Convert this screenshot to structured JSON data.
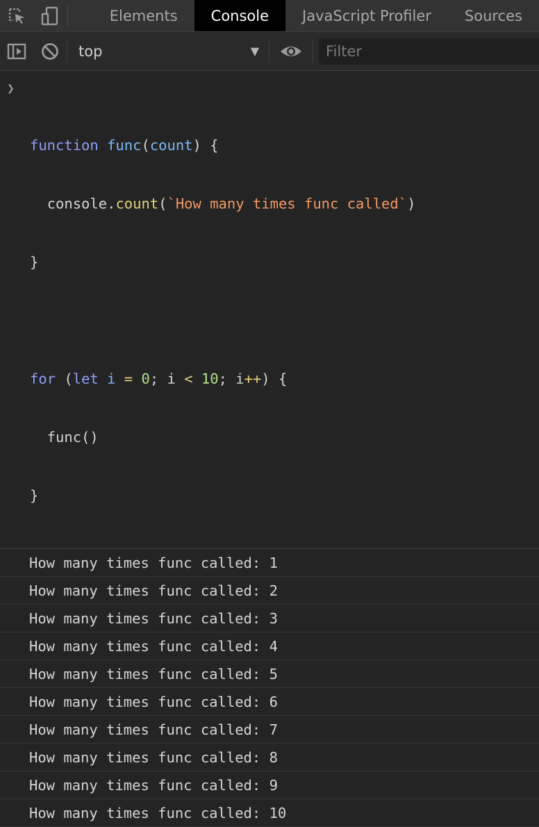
{
  "tabs": [
    {
      "label": "Elements",
      "active": false
    },
    {
      "label": "Console",
      "active": true
    },
    {
      "label": "JavaScript Profiler",
      "active": false
    },
    {
      "label": "Sources",
      "active": false
    }
  ],
  "toolbar": {
    "context": "top",
    "filter_placeholder": "Filter"
  },
  "input_code": {
    "line1": {
      "kw": "function",
      "name": "func",
      "paren_open": "(",
      "param": "count",
      "rest": ") {"
    },
    "line2": {
      "indent": "  ",
      "obj": "console.",
      "method": "count",
      "paren_open": "(",
      "str": "`How many times func called`",
      "paren_close": ")"
    },
    "line3": "}",
    "line5": {
      "kw": "for",
      "p1": " (",
      "let": "let",
      "sp": " ",
      "var": "i",
      "eq": " = ",
      "zero": "0",
      "semi1": "; i ",
      "lt": "<",
      "sp2": " ",
      "ten": "10",
      "semi2": "; i",
      "inc": "++",
      "rest": ") {"
    },
    "line6": "  func()",
    "line7": "}"
  },
  "output": [
    "How many times func called: 1",
    "How many times func called: 2",
    "How many times func called: 3",
    "How many times func called: 4",
    "How many times func called: 5",
    "How many times func called: 6",
    "How many times func called: 7",
    "How many times func called: 8",
    "How many times func called: 9",
    "How many times func called: 10"
  ],
  "colors": {
    "keyword": "#8f9df7",
    "function_name": "#7bb8f6",
    "string": "#f29866",
    "number": "#b5e08a",
    "operator": "#e4cf79"
  },
  "icons": [
    "inspect-element-icon",
    "device-toolbar-icon",
    "show-sidebar-icon",
    "clear-console-icon",
    "dropdown-caret-icon",
    "live-expression-eye-icon",
    "prompt-chevron-icon"
  ]
}
